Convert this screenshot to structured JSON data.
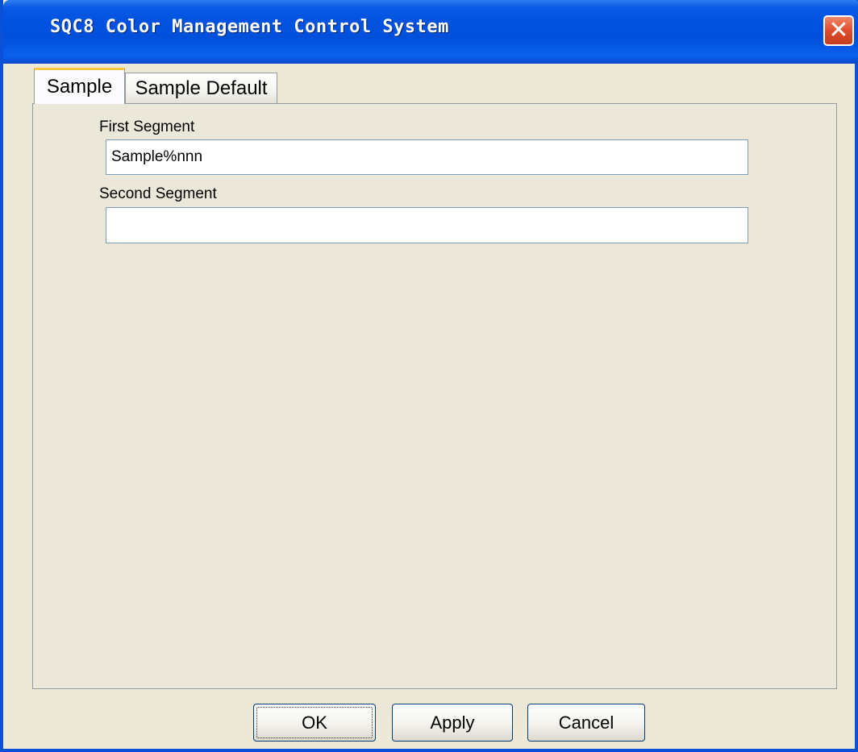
{
  "window": {
    "title": "SQC8 Color Management Control System",
    "close_glyph": "✕"
  },
  "tabs": [
    {
      "label": "Sample",
      "active": true
    },
    {
      "label": "Sample Default",
      "active": false
    }
  ],
  "form": {
    "first_segment": {
      "label": "First Segment",
      "value": "Sample%nnn"
    },
    "second_segment": {
      "label": "Second Segment",
      "value": ""
    }
  },
  "buttons": {
    "ok": "OK",
    "apply": "Apply",
    "cancel": "Cancel"
  },
  "colors": {
    "titlebar": "#0a5ae6",
    "active_tab_accent": "#ffc83c",
    "close_button": "#e0502e",
    "dialog_background": "#ece9d8"
  }
}
